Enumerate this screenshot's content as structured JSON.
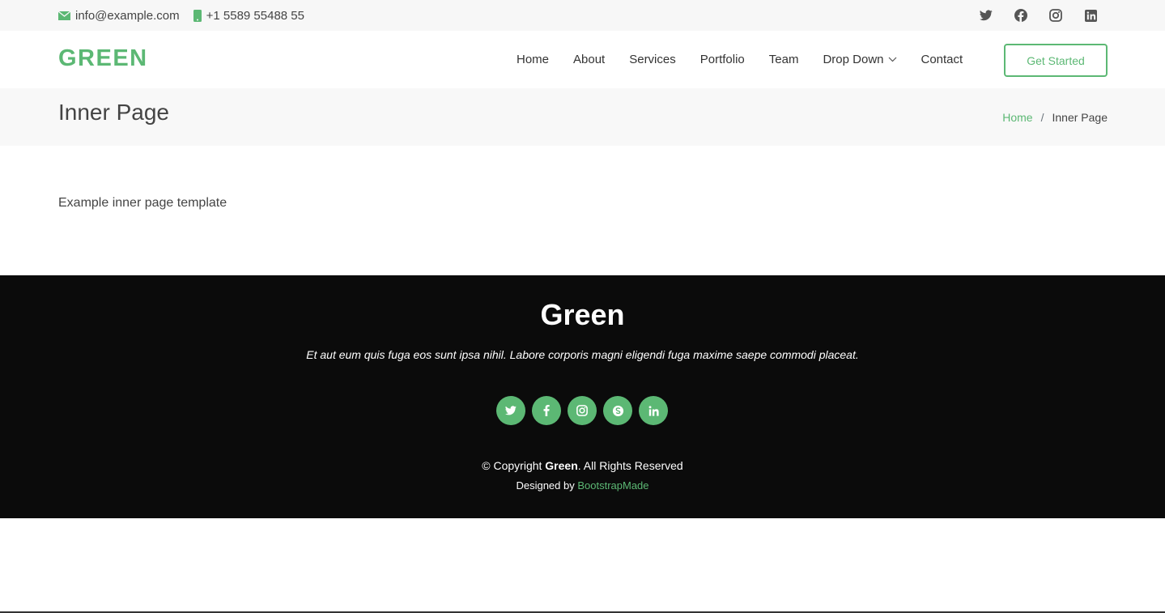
{
  "topbar": {
    "email": "info@example.com",
    "phone": "+1 5589 55488 55",
    "social_icons": [
      "twitter-icon",
      "facebook-icon",
      "instagram-icon",
      "linkedin-icon"
    ]
  },
  "header": {
    "logo": "GREEN",
    "nav": [
      "Home",
      "About",
      "Services",
      "Portfolio",
      "Team",
      "Drop Down",
      "Contact"
    ],
    "cta": "Get Started"
  },
  "breadcrumbs": {
    "title": "Inner Page",
    "home": "Home",
    "separator": "/",
    "current": "Inner Page"
  },
  "main": {
    "text": "Example inner page template"
  },
  "footer": {
    "brand": "Green",
    "tagline": "Et aut eum quis fuga eos sunt ipsa nihil. Labore corporis magni eligendi fuga maxime saepe commodi placeat.",
    "social_icons": [
      "twitter-icon",
      "facebook-icon",
      "instagram-icon",
      "skype-icon",
      "linkedin-icon"
    ],
    "copyright_prefix": "© Copyright ",
    "copyright_brand": "Green",
    "copyright_suffix": ". All Rights Reserved",
    "credits_prefix": "Designed by ",
    "credits_link": "BootstrapMade"
  },
  "colors": {
    "accent": "#5cb874",
    "footer_bg": "#0b0b0b",
    "topbar_bg": "#f7f7f7",
    "breadcrumbs_bg": "#f8f8f8"
  }
}
